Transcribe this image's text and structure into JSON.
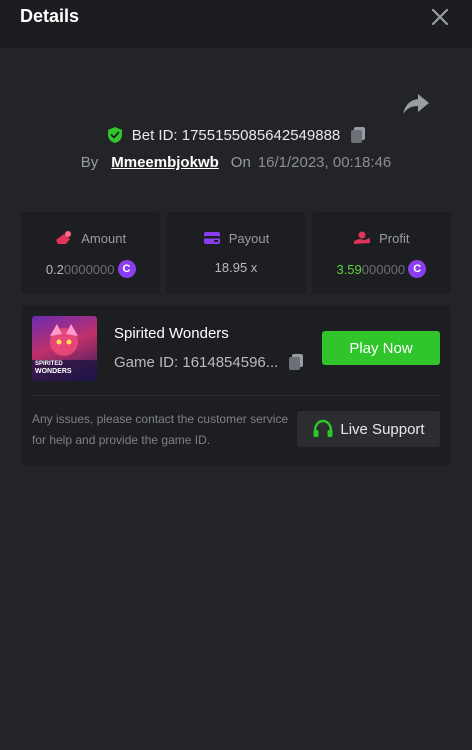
{
  "header": {
    "title": "Details"
  },
  "bet": {
    "id_text": "Bet ID: 1755155085642549888",
    "by_label": "By",
    "username": "Mmeembjokwb",
    "on_label": "On",
    "datetime": "16/1/2023, 00:18:46"
  },
  "stats": {
    "amount": {
      "label": "Amount",
      "value_main": "0.2",
      "value_dim": "0000000"
    },
    "payout": {
      "label": "Payout",
      "value": "18.95 x"
    },
    "profit": {
      "label": "Profit",
      "value_main": "3.59",
      "value_dim": "000000"
    }
  },
  "game": {
    "name": "Spirited Wonders",
    "id_text": "Game ID: 1614854596...",
    "thumb_title_1": "SPIRITED",
    "thumb_title_2": "WONDERS",
    "play_label": "Play Now"
  },
  "support": {
    "text": "Any issues, please contact the customer service for help and provide the game ID.",
    "button_label": "Live Support"
  },
  "icons": {
    "close": "close-icon",
    "share": "share-icon",
    "shield": "shield-check-icon",
    "copy": "copy-icon",
    "amount": "amount-icon",
    "payout": "wallet-icon",
    "profit": "profit-icon",
    "coin": "coin-icon",
    "headset": "headset-icon"
  },
  "colors": {
    "accent_green": "#2fc52b",
    "profit_green": "#5fd43b",
    "coin_purple": "#8b3df0",
    "amount_red": "#e0345a",
    "payout_purple": "#8a3df2"
  }
}
